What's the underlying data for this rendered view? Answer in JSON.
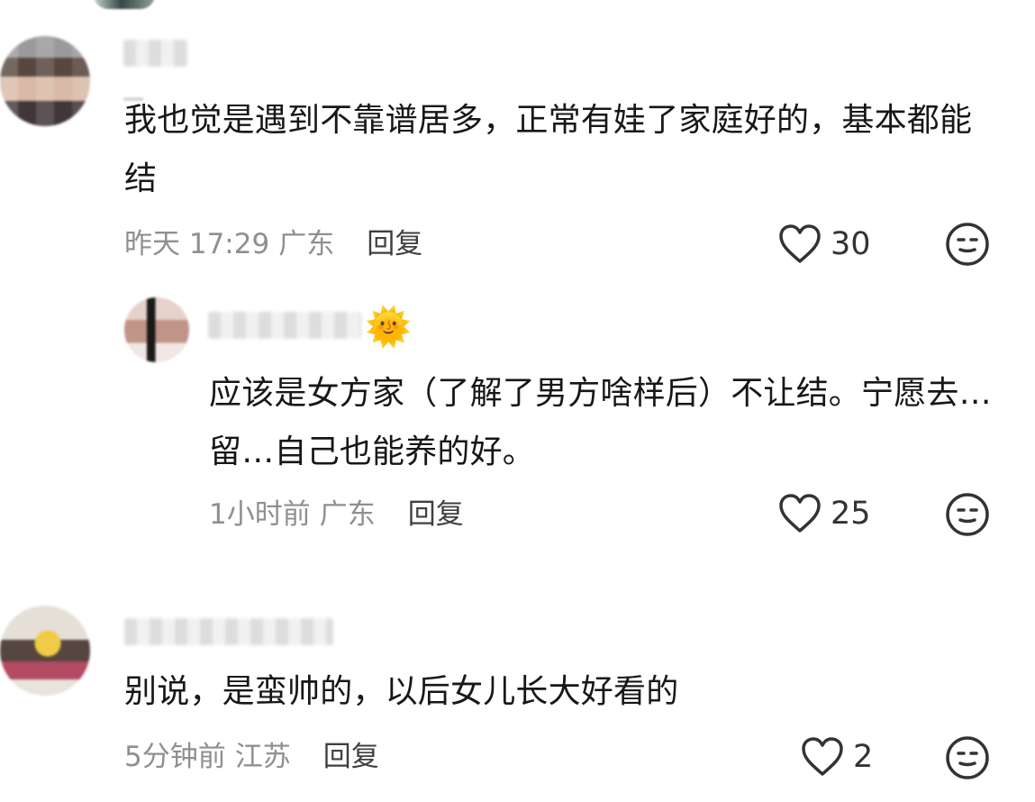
{
  "comments": [
    {
      "text": "我也觉是遇到不靠谱居多，正常有娃了家庭好的，基本都能结",
      "time": "昨天 17:29",
      "location": "广东",
      "reply_label": "回复",
      "likes": "30",
      "avatar_icon": "blurred-user-avatar",
      "like_icon": "heart-outline-icon",
      "reaction_icon": "neutral-face-icon"
    },
    {
      "text": "应该是女方家（了解了男方啥样后）不让结。宁愿去…留…自己也能养的好。",
      "time": "1小时前",
      "location": "广东",
      "reply_label": "回复",
      "likes": "25",
      "avatar_icon": "blurred-user-avatar",
      "name_emoji": "🌞",
      "like_icon": "heart-outline-icon",
      "reaction_icon": "neutral-face-icon"
    },
    {
      "text": "别说，是蛮帅的，以后女儿长大好看的",
      "time": "5分钟前",
      "location": "江苏",
      "reply_label": "回复",
      "likes": "2",
      "avatar_icon": "blurred-user-avatar",
      "like_icon": "heart-outline-icon",
      "reaction_icon": "neutral-face-icon"
    }
  ],
  "colors": {
    "background": "#ffffff",
    "primary_text": "#171717",
    "secondary_text": "#8f8f8f",
    "reply_text": "#3f3f3f",
    "icon_stroke": "#333333",
    "sun_emoji": "#f1ac10"
  }
}
